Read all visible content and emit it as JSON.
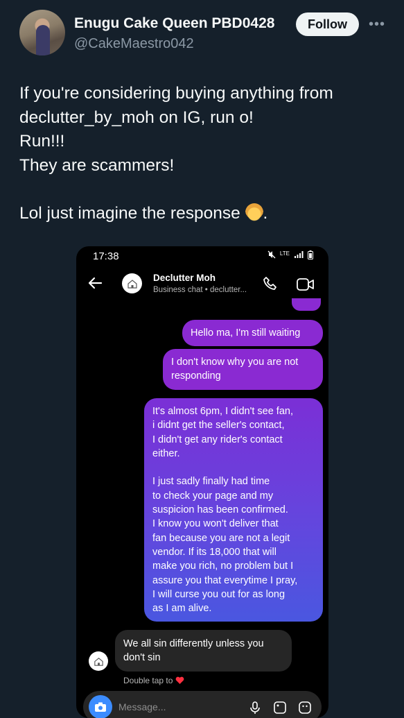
{
  "tweet": {
    "display_name": "Enugu Cake Queen PBD0428",
    "handle": "@CakeMaestro042",
    "follow_label": "Follow",
    "more_label": "•••",
    "lines": [
      "If you're considering buying anything from",
      "declutter_by_moh on IG, run o!",
      "Run!!!",
      "They are scammers!",
      "",
      "Lol just imagine the response"
    ],
    "last_line_suffix": "."
  },
  "chat": {
    "status_time": "17:38",
    "status_right": "LTE",
    "contact_name": "Declutter Moh",
    "contact_sub": "Business chat • declutter...",
    "messages": [
      {
        "side": "sent",
        "lines": [
          "Hello ma, I'm still waiting"
        ]
      },
      {
        "side": "sent",
        "lines": [
          "I don't know why you are not",
          "responding"
        ]
      },
      {
        "side": "sent",
        "lines": [
          "It's almost 6pm, I didn't see fan,",
          "i didnt get the seller's contact,",
          "I didn't get any rider's contact",
          "either.",
          "",
          "I just sadly finally had time",
          "to check your page and my",
          "suspicion has been confirmed.",
          "I know you won't deliver that",
          "fan because you are not a legit",
          "vendor. If its 18,000 that will",
          "make you rich, no problem but I",
          "assure you that everytime I pray,",
          "I will curse you out for as long",
          "as I am alive."
        ]
      },
      {
        "side": "received",
        "lines": [
          "We all sin differently unless you",
          "don't sin"
        ]
      }
    ],
    "double_tap_text": "Double tap to",
    "composer_placeholder": "Message...",
    "colors": {
      "sent_bubble": "#8a2ad2",
      "received_bubble": "#262626",
      "gradient_end": "#4a57e0"
    }
  }
}
